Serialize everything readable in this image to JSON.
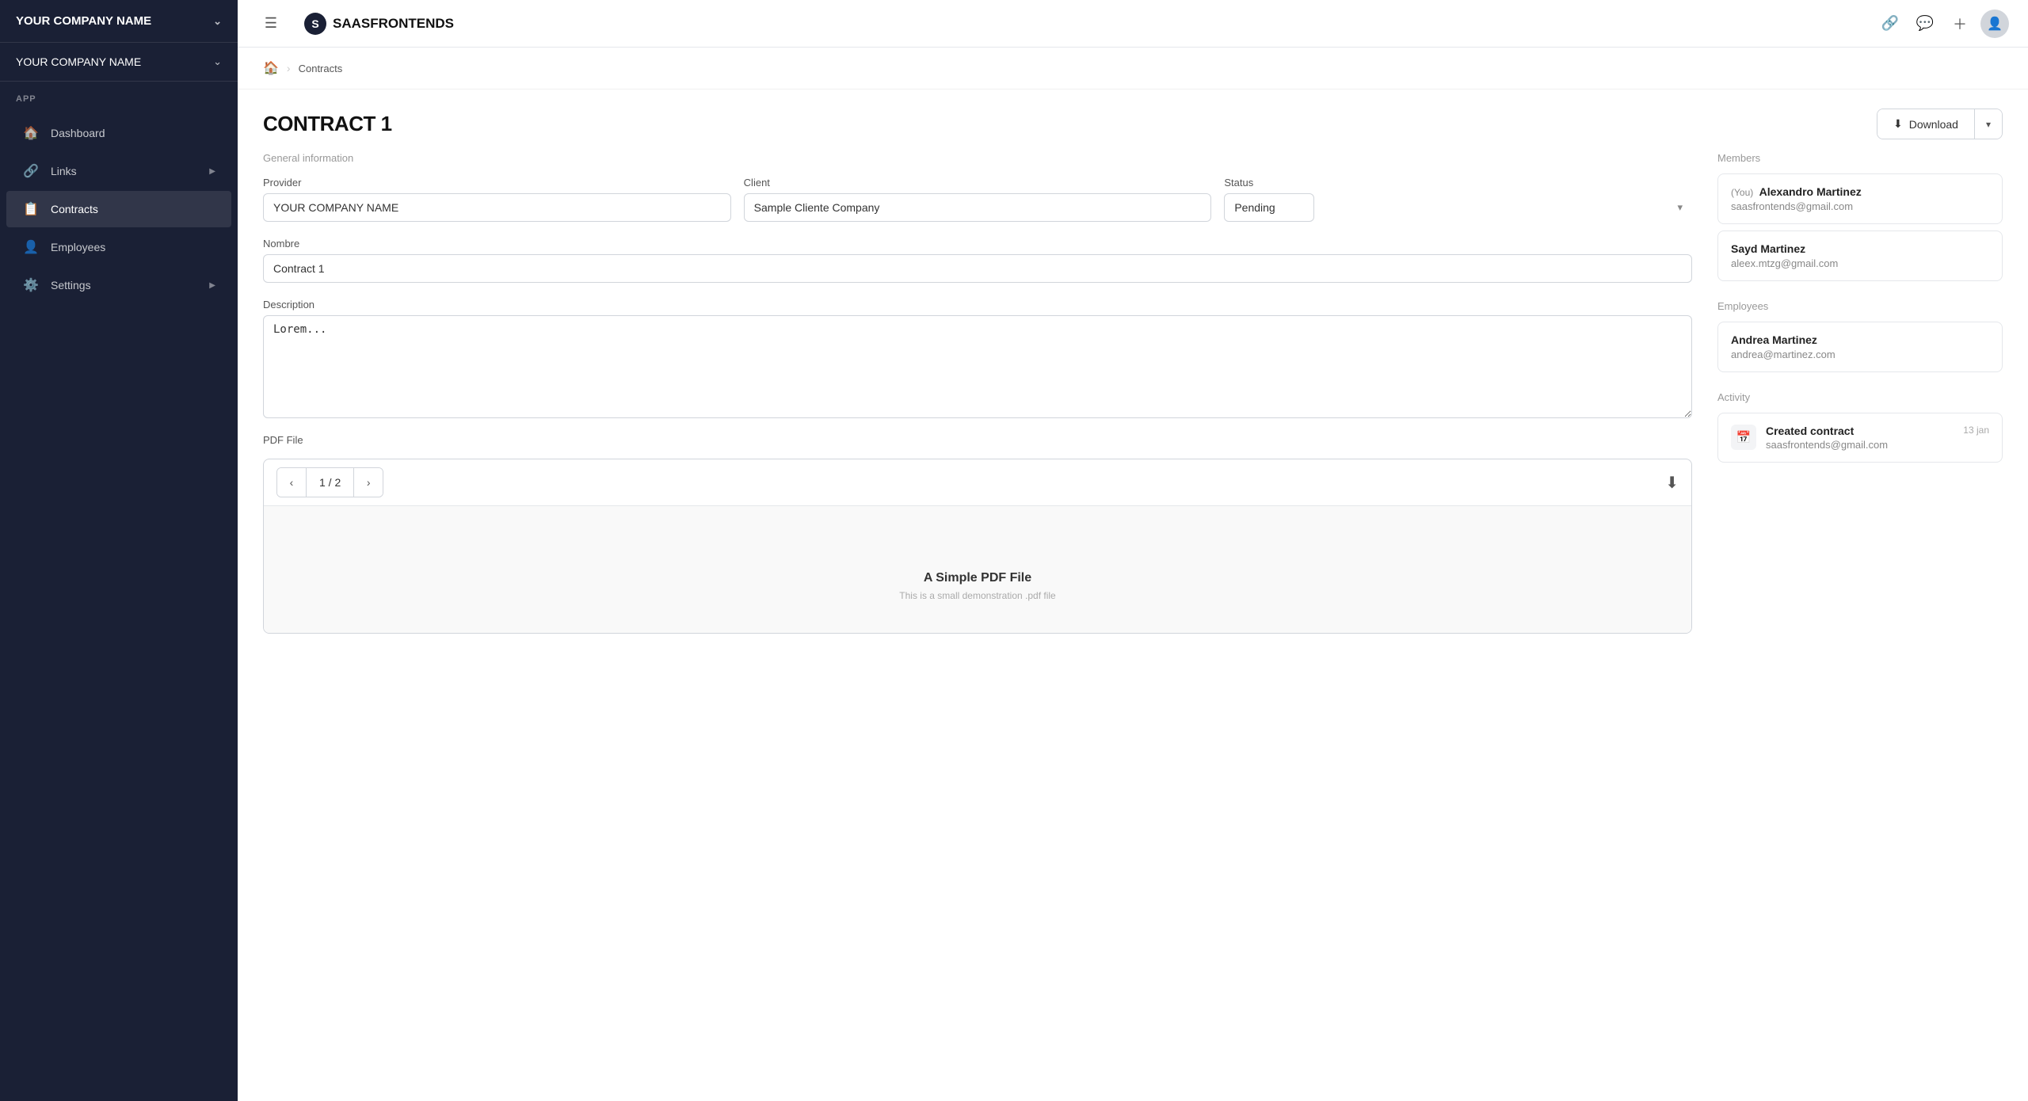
{
  "sidebar": {
    "company_top": "YOUR COMPANY NAME",
    "company_second": "YOUR COMPANY NAME",
    "app_label": "APP",
    "nav": [
      {
        "id": "dashboard",
        "label": "Dashboard",
        "icon": "🏠",
        "hasArrow": false
      },
      {
        "id": "links",
        "label": "Links",
        "icon": "🔗",
        "hasArrow": true
      },
      {
        "id": "contracts",
        "label": "Contracts",
        "icon": "📋",
        "hasArrow": false,
        "active": true
      },
      {
        "id": "employees",
        "label": "Employees",
        "icon": "👤",
        "hasArrow": false
      },
      {
        "id": "settings",
        "label": "Settings",
        "icon": "⚙️",
        "hasArrow": true
      }
    ]
  },
  "topbar": {
    "logo_text_saas": "SAAS",
    "logo_text_frontends": "FRONTENDS"
  },
  "breadcrumb": {
    "contracts": "Contracts"
  },
  "page": {
    "title": "CONTRACT 1",
    "download_label": "Download"
  },
  "form": {
    "general_info_label": "General information",
    "provider_label": "Provider",
    "provider_value": "YOUR COMPANY NAME",
    "client_label": "Client",
    "client_value": "Sample Cliente Company",
    "status_label": "Status",
    "status_value": "Pending",
    "nombre_label": "Nombre",
    "nombre_value": "Contract 1",
    "description_label": "Description",
    "description_value": "Lorem...",
    "pdf_label": "PDF File",
    "pdf_page": "1 / 2",
    "pdf_title": "A Simple PDF File",
    "pdf_subtitle": "This is a small demonstration .pdf file"
  },
  "sidebar_right": {
    "members_label": "Members",
    "members": [
      {
        "you": "(You)",
        "name": "Alexandro Martinez",
        "email": "saasfrontends@gmail.com"
      },
      {
        "you": "",
        "name": "Sayd Martinez",
        "email": "aleex.mtzg@gmail.com"
      }
    ],
    "employees_label": "Employees",
    "employees": [
      {
        "name": "Andrea Martinez",
        "email": "andrea@martinez.com"
      }
    ],
    "activity_label": "Activity",
    "activity": [
      {
        "title": "Created contract",
        "email": "saasfrontends@gmail.com",
        "date": "13 jan"
      }
    ]
  }
}
